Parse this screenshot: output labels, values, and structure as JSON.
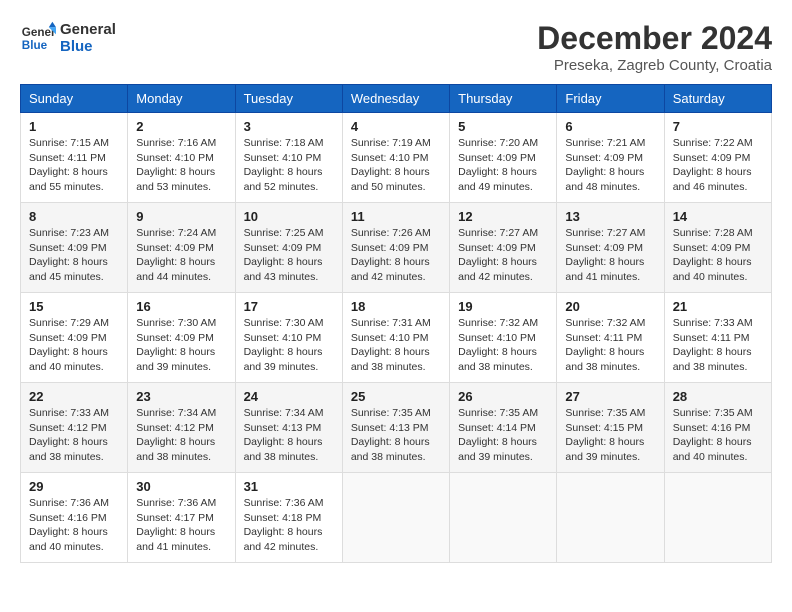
{
  "header": {
    "logo_general": "General",
    "logo_blue": "Blue",
    "month_title": "December 2024",
    "location": "Preseka, Zagreb County, Croatia"
  },
  "weekdays": [
    "Sunday",
    "Monday",
    "Tuesday",
    "Wednesday",
    "Thursday",
    "Friday",
    "Saturday"
  ],
  "weeks": [
    [
      {
        "day": "1",
        "sunrise": "Sunrise: 7:15 AM",
        "sunset": "Sunset: 4:11 PM",
        "daylight": "Daylight: 8 hours and 55 minutes."
      },
      {
        "day": "2",
        "sunrise": "Sunrise: 7:16 AM",
        "sunset": "Sunset: 4:10 PM",
        "daylight": "Daylight: 8 hours and 53 minutes."
      },
      {
        "day": "3",
        "sunrise": "Sunrise: 7:18 AM",
        "sunset": "Sunset: 4:10 PM",
        "daylight": "Daylight: 8 hours and 52 minutes."
      },
      {
        "day": "4",
        "sunrise": "Sunrise: 7:19 AM",
        "sunset": "Sunset: 4:10 PM",
        "daylight": "Daylight: 8 hours and 50 minutes."
      },
      {
        "day": "5",
        "sunrise": "Sunrise: 7:20 AM",
        "sunset": "Sunset: 4:09 PM",
        "daylight": "Daylight: 8 hours and 49 minutes."
      },
      {
        "day": "6",
        "sunrise": "Sunrise: 7:21 AM",
        "sunset": "Sunset: 4:09 PM",
        "daylight": "Daylight: 8 hours and 48 minutes."
      },
      {
        "day": "7",
        "sunrise": "Sunrise: 7:22 AM",
        "sunset": "Sunset: 4:09 PM",
        "daylight": "Daylight: 8 hours and 46 minutes."
      }
    ],
    [
      {
        "day": "8",
        "sunrise": "Sunrise: 7:23 AM",
        "sunset": "Sunset: 4:09 PM",
        "daylight": "Daylight: 8 hours and 45 minutes."
      },
      {
        "day": "9",
        "sunrise": "Sunrise: 7:24 AM",
        "sunset": "Sunset: 4:09 PM",
        "daylight": "Daylight: 8 hours and 44 minutes."
      },
      {
        "day": "10",
        "sunrise": "Sunrise: 7:25 AM",
        "sunset": "Sunset: 4:09 PM",
        "daylight": "Daylight: 8 hours and 43 minutes."
      },
      {
        "day": "11",
        "sunrise": "Sunrise: 7:26 AM",
        "sunset": "Sunset: 4:09 PM",
        "daylight": "Daylight: 8 hours and 42 minutes."
      },
      {
        "day": "12",
        "sunrise": "Sunrise: 7:27 AM",
        "sunset": "Sunset: 4:09 PM",
        "daylight": "Daylight: 8 hours and 42 minutes."
      },
      {
        "day": "13",
        "sunrise": "Sunrise: 7:27 AM",
        "sunset": "Sunset: 4:09 PM",
        "daylight": "Daylight: 8 hours and 41 minutes."
      },
      {
        "day": "14",
        "sunrise": "Sunrise: 7:28 AM",
        "sunset": "Sunset: 4:09 PM",
        "daylight": "Daylight: 8 hours and 40 minutes."
      }
    ],
    [
      {
        "day": "15",
        "sunrise": "Sunrise: 7:29 AM",
        "sunset": "Sunset: 4:09 PM",
        "daylight": "Daylight: 8 hours and 40 minutes."
      },
      {
        "day": "16",
        "sunrise": "Sunrise: 7:30 AM",
        "sunset": "Sunset: 4:09 PM",
        "daylight": "Daylight: 8 hours and 39 minutes."
      },
      {
        "day": "17",
        "sunrise": "Sunrise: 7:30 AM",
        "sunset": "Sunset: 4:10 PM",
        "daylight": "Daylight: 8 hours and 39 minutes."
      },
      {
        "day": "18",
        "sunrise": "Sunrise: 7:31 AM",
        "sunset": "Sunset: 4:10 PM",
        "daylight": "Daylight: 8 hours and 38 minutes."
      },
      {
        "day": "19",
        "sunrise": "Sunrise: 7:32 AM",
        "sunset": "Sunset: 4:10 PM",
        "daylight": "Daylight: 8 hours and 38 minutes."
      },
      {
        "day": "20",
        "sunrise": "Sunrise: 7:32 AM",
        "sunset": "Sunset: 4:11 PM",
        "daylight": "Daylight: 8 hours and 38 minutes."
      },
      {
        "day": "21",
        "sunrise": "Sunrise: 7:33 AM",
        "sunset": "Sunset: 4:11 PM",
        "daylight": "Daylight: 8 hours and 38 minutes."
      }
    ],
    [
      {
        "day": "22",
        "sunrise": "Sunrise: 7:33 AM",
        "sunset": "Sunset: 4:12 PM",
        "daylight": "Daylight: 8 hours and 38 minutes."
      },
      {
        "day": "23",
        "sunrise": "Sunrise: 7:34 AM",
        "sunset": "Sunset: 4:12 PM",
        "daylight": "Daylight: 8 hours and 38 minutes."
      },
      {
        "day": "24",
        "sunrise": "Sunrise: 7:34 AM",
        "sunset": "Sunset: 4:13 PM",
        "daylight": "Daylight: 8 hours and 38 minutes."
      },
      {
        "day": "25",
        "sunrise": "Sunrise: 7:35 AM",
        "sunset": "Sunset: 4:13 PM",
        "daylight": "Daylight: 8 hours and 38 minutes."
      },
      {
        "day": "26",
        "sunrise": "Sunrise: 7:35 AM",
        "sunset": "Sunset: 4:14 PM",
        "daylight": "Daylight: 8 hours and 39 minutes."
      },
      {
        "day": "27",
        "sunrise": "Sunrise: 7:35 AM",
        "sunset": "Sunset: 4:15 PM",
        "daylight": "Daylight: 8 hours and 39 minutes."
      },
      {
        "day": "28",
        "sunrise": "Sunrise: 7:35 AM",
        "sunset": "Sunset: 4:16 PM",
        "daylight": "Daylight: 8 hours and 40 minutes."
      }
    ],
    [
      {
        "day": "29",
        "sunrise": "Sunrise: 7:36 AM",
        "sunset": "Sunset: 4:16 PM",
        "daylight": "Daylight: 8 hours and 40 minutes."
      },
      {
        "day": "30",
        "sunrise": "Sunrise: 7:36 AM",
        "sunset": "Sunset: 4:17 PM",
        "daylight": "Daylight: 8 hours and 41 minutes."
      },
      {
        "day": "31",
        "sunrise": "Sunrise: 7:36 AM",
        "sunset": "Sunset: 4:18 PM",
        "daylight": "Daylight: 8 hours and 42 minutes."
      },
      null,
      null,
      null,
      null
    ]
  ]
}
